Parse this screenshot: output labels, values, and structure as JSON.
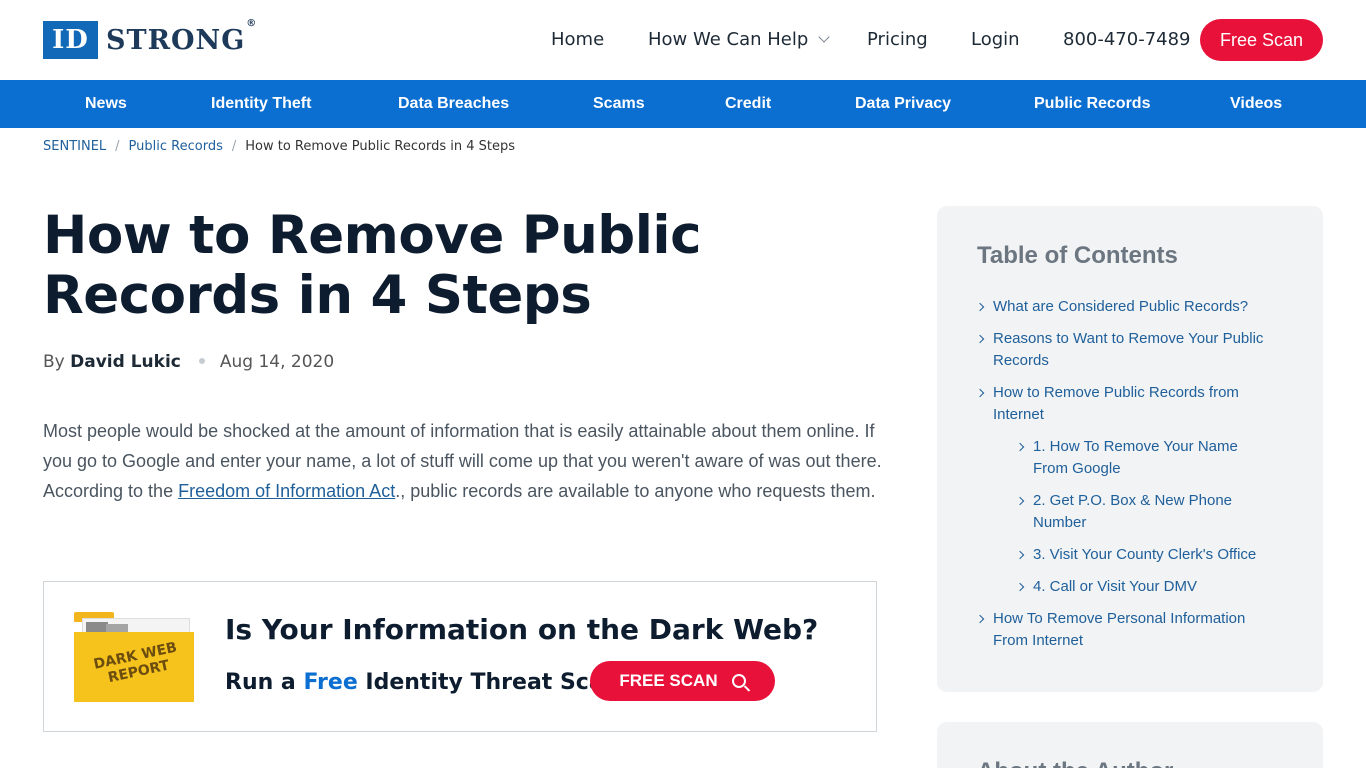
{
  "header": {
    "logo_id": "ID",
    "logo_strong": "STRONG",
    "logo_reg": "®",
    "nav": {
      "home": "Home",
      "help": "How We Can Help",
      "pricing": "Pricing",
      "login": "Login",
      "phone": "800-470-7489"
    },
    "cta": "Free Scan"
  },
  "subnav": [
    "News",
    "Identity Theft",
    "Data Breaches",
    "Scams",
    "Credit",
    "Data Privacy",
    "Public Records",
    "Videos"
  ],
  "breadcrumb": {
    "root": "SENTINEL",
    "section": "Public Records",
    "current": "How to Remove Public Records in 4 Steps",
    "separator": "/"
  },
  "article": {
    "title": "How to Remove Public Records in 4 Steps",
    "by": "By",
    "author": "David Lukic",
    "date": "Aug 14, 2020",
    "intro_before": "Most people would be shocked at the amount of information that is easily attainable about them online. If you go to Google and enter your name, a lot of stuff will come up that you weren't aware of was out there. According to the ",
    "intro_link": "Freedom of Information Act",
    "intro_after": "., public records are available to anyone who requests them."
  },
  "promo": {
    "folder_text": "DARK WEB REPORT",
    "headline": "Is Your Information on the Dark Web?",
    "sub_before": "Run a ",
    "sub_free": "Free",
    "sub_after": " Identity Threat Scan",
    "button": "FREE SCAN"
  },
  "toc": {
    "title": "Table of Contents",
    "items": [
      "What are Considered Public Records?",
      "Reasons to Want to Remove Your Public Records",
      "How to Remove Public Records from Internet",
      "1. How To Remove Your Name From Google",
      "2. Get P.O. Box & New Phone Number",
      "3. Visit Your County Clerk's Office",
      "4. Call or Visit Your DMV",
      "How To Remove Personal Information From Internet"
    ]
  },
  "author_box": {
    "title": "About the Author"
  },
  "colors": {
    "brand_blue": "#0b6ed1",
    "cta_red": "#e8113a",
    "navy": "#0d1c2e"
  }
}
